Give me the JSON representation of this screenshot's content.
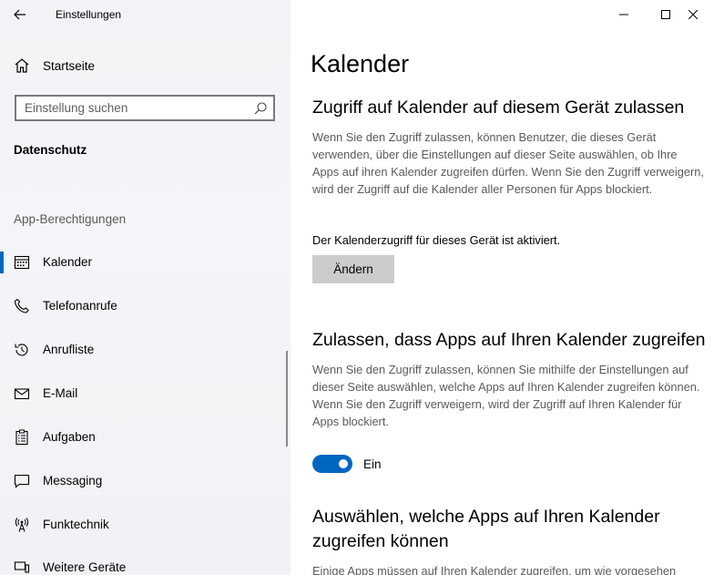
{
  "window": {
    "app_title": "Einstellungen"
  },
  "sidebar": {
    "home_label": "Startseite",
    "search_placeholder": "Einstellung suchen",
    "section_title": "Datenschutz",
    "group_title": "App-Berechtigungen",
    "items": [
      {
        "label": "Kalender",
        "icon": "calendar-icon",
        "active": true
      },
      {
        "label": "Telefonanrufe",
        "icon": "phone-icon"
      },
      {
        "label": "Anrufliste",
        "icon": "history-icon"
      },
      {
        "label": "E-Mail",
        "icon": "mail-icon"
      },
      {
        "label": "Aufgaben",
        "icon": "tasks-icon"
      },
      {
        "label": "Messaging",
        "icon": "chat-icon"
      },
      {
        "label": "Funktechnik",
        "icon": "radio-icon"
      },
      {
        "label": "Weitere Geräte",
        "icon": "devices-icon"
      }
    ]
  },
  "main": {
    "title": "Kalender",
    "device_section": {
      "heading": "Zugriff auf Kalender auf diesem Gerät zulassen",
      "description": "Wenn Sie den Zugriff zulassen, können Benutzer, die dieses Gerät verwenden, über die Einstellungen auf dieser Seite auswählen, ob Ihre Apps auf ihren Kalender zugreifen dürfen. Wenn Sie den Zugriff verweigern, wird der Zugriff auf die Kalender aller Personen für Apps blockiert.",
      "status": "Der Kalenderzugriff für dieses Gerät ist aktiviert.",
      "change_button": "Ändern"
    },
    "apps_section": {
      "heading": "Zulassen, dass Apps auf Ihren Kalender zugreifen",
      "description": "Wenn Sie den Zugriff zulassen, können Sie mithilfe der Einstellungen auf dieser Seite auswählen, welche Apps auf Ihren Kalender zugreifen können. Wenn Sie den Zugriff verweigern, wird der Zugriff auf Ihren Kalender für Apps blockiert.",
      "toggle_label": "Ein",
      "toggle_on": true
    },
    "choose_section": {
      "heading": "Auswählen, welche Apps auf Ihren Kalender zugreifen können",
      "description": "Einige Apps müssen auf Ihren Kalender zugreifen, um wie vorgesehen"
    }
  },
  "colors": {
    "accent": "#0067c0",
    "sidebar_bg": "#f2f3f6",
    "button_bg": "#cccccc"
  }
}
